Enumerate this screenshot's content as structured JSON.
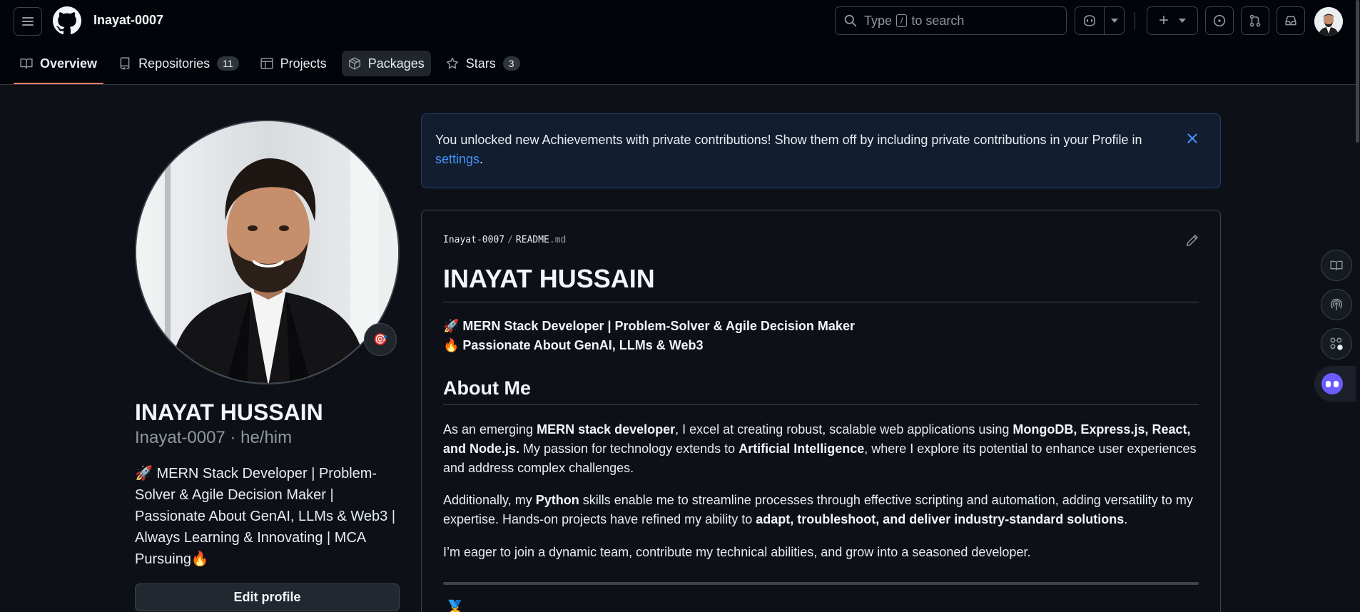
{
  "header": {
    "username": "Inayat-0007",
    "search": {
      "prefix": "Type",
      "key": "/",
      "suffix": "to search"
    },
    "create_symbol": "+"
  },
  "tabs": [
    {
      "label": "Overview",
      "icon": "book-icon",
      "active": true
    },
    {
      "label": "Repositories",
      "icon": "repo-icon",
      "count": "11"
    },
    {
      "label": "Projects",
      "icon": "table-icon"
    },
    {
      "label": "Packages",
      "icon": "package-icon"
    },
    {
      "label": "Stars",
      "icon": "star-icon",
      "count": "3"
    }
  ],
  "profile": {
    "name": "INAYAT HUSSAIN",
    "login_line": "Inayat-0007 · he/him",
    "status_emoji": "🎯",
    "bio": "🚀 MERN Stack Developer | Problem-Solver & Agile Decision Maker | Passionate About GenAI, LLMs & Web3 | Always Learning & Innovating | MCA Pursuing🔥",
    "edit_label": "Edit profile"
  },
  "flash": {
    "text": "You unlocked new Achievements with private contributions! Show them off by including private contributions in your Profile in ",
    "link": "settings",
    "tail": "."
  },
  "readme": {
    "owner": "Inayat-0007",
    "sep": "/",
    "file": "README",
    "ext": ".md",
    "title": "INAYAT HUSSAIN",
    "tagline1": "🚀 MERN Stack Developer | Problem-Solver & Agile Decision Maker",
    "tagline2": "🔥 Passionate About GenAI, LLMs & Web3",
    "about_heading": "About Me",
    "p1": {
      "t1": "As an emerging ",
      "b1": "MERN stack developer",
      "t2": ", I excel at creating robust, scalable web applications using ",
      "b2": "MongoDB, Express.js, React, and Node.js.",
      "t3": " My passion for technology extends to ",
      "b3": "Artificial Intelligence",
      "t4": ", where I explore its potential to enhance user experiences and address complex challenges."
    },
    "p2": {
      "t1": "Additionally, my ",
      "b1": "Python",
      "t2": " skills enable me to streamline processes through effective scripting and automation, adding versatility to my expertise. Hands-on projects have refined my ability to ",
      "b2": "adapt, troubleshoot, and deliver industry-standard solutions",
      "t3": "."
    },
    "p3": "I’m eager to join a dynamic team, contribute my technical abilities, and grow into a seasoned developer."
  },
  "colors": {
    "background": "#0d1117",
    "header_bg": "#010409",
    "accent_underline": "#f78166",
    "link": "#4493f8",
    "flash_bg": "#121d2f"
  }
}
